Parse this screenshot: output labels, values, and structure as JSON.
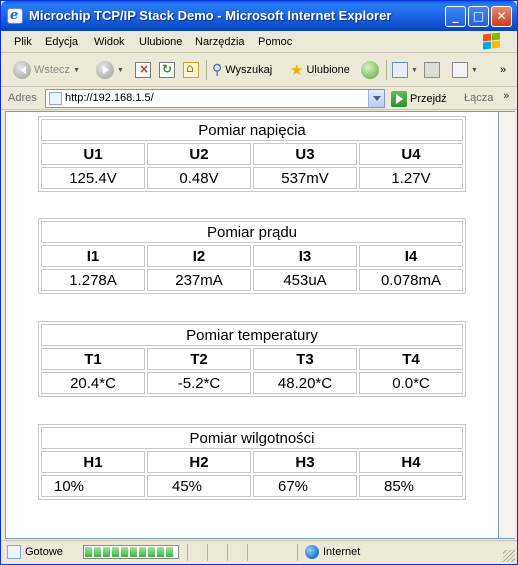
{
  "window": {
    "title": "Microchip TCP/IP Stack Demo - Microsoft Internet Explorer",
    "controls": {
      "minimize": "_",
      "maximize": "□",
      "close": "✕"
    }
  },
  "menu": [
    "Plik",
    "Edycja",
    "Widok",
    "Ulubione",
    "Narzędzia",
    "Pomoc"
  ],
  "toolbar": {
    "back": "Wstecz",
    "search": "Wyszukaj",
    "favorites": "Ulubione"
  },
  "address": {
    "label": "Adres",
    "url": "http://192.168.1.5/",
    "go": "Przejdź",
    "links": "Łącza",
    "links_more": "»"
  },
  "panels": [
    {
      "caption": "Pomiar napięcia",
      "headers": [
        "U1",
        "U2",
        "U3",
        "U4"
      ],
      "values": [
        "125.4V",
        "0.48V",
        "537mV",
        "1.27V"
      ]
    },
    {
      "caption": "Pomiar prądu",
      "headers": [
        "I1",
        "I2",
        "I3",
        "I4"
      ],
      "values": [
        "1.278A",
        "237mA",
        "453uA",
        "0.078mA"
      ]
    },
    {
      "caption": "Pomiar temperatury",
      "headers": [
        "T1",
        "T2",
        "T3",
        "T4"
      ],
      "values": [
        "20.4*C",
        "-5.2*C",
        "48.20*C",
        "0.0*C"
      ]
    },
    {
      "caption": "Pomiar wilgotności",
      "headers": [
        "H1",
        "H2",
        "H3",
        "H4"
      ],
      "values": [
        "10%",
        "45%",
        "67%",
        "85%"
      ]
    }
  ],
  "status": {
    "text": "Gotowe",
    "zone": "Internet",
    "progress_fraction": 1.0
  },
  "colors": {
    "titlebar": "#0a4ecb",
    "window_face": "#ece9d8",
    "table_border": "#c8c8c8"
  }
}
